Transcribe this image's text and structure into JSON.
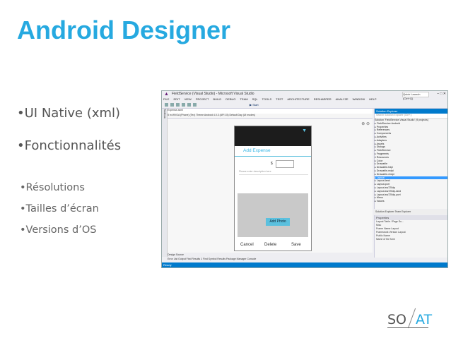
{
  "slide": {
    "title": "Android Designer",
    "bullets": [
      "•UI Native (xml)",
      "•Fonctionnalités"
    ],
    "sub_bullets": [
      "•Résolutions",
      "•Tailles d’écran",
      "•Versions d’OS"
    ]
  },
  "ide": {
    "title": "FieldService (Visual Studio) - Microsoft Visual Studio",
    "menu": [
      "FILE",
      "EDIT",
      "VIEW",
      "PROJECT",
      "BUILD",
      "DEBUG",
      "TEAM",
      "SQL",
      "TOOLS",
      "TEST",
      "ARCHITECTURE",
      "RESHARPER",
      "ANALYZE",
      "WINDOW",
      "HELP"
    ],
    "quick_launch": "Quick Launch (Ctrl+Q)",
    "start_label": "▶ Start",
    "designer_tab": "Expense.axml",
    "designer_bar": "5 in WVGA (Phone) (Tex)  Theme  Android 4.0.3 (API 15)  Default  Day  (UI modes)",
    "toolbox_label": "Toolbox",
    "zoom": "⊕ ⊖",
    "phone": {
      "header": "Add Expense",
      "currency": "$",
      "description_placeholder": "Please enter description here",
      "photo_button": "Add Photo",
      "actions": [
        "Cancel",
        "Delete",
        "Save"
      ]
    },
    "solution_explorer": {
      "title": "Solution Explorer",
      "search": "Search Solution Explorer (Ctrl+;)",
      "items": [
        "Solution 'FieldService.Visual Studio' (9 projects)",
        "▸ FieldService.Android",
        "   ▸ Properties",
        "   ▸ References",
        "   ▸ Components",
        "   ▸ Activities",
        "   ▸ Adapters",
        "   ▸ Assets",
        "   ▸ Dialogs",
        "   ▸ FieldService",
        "   ▸ Fragments",
        "   ▾ Resources",
        "      ▸ Color",
        "      ▸ Drawable",
        "      ▸ Drawable-hdpi",
        "      ▸ Drawable-mdpi",
        "      ▸ Drawable-xhdpi",
        "      ▸ Layout",
        "      ▸ Layout-land",
        "      ▸ Layout-port",
        "      ▸ Layout-sw720dp",
        "      ▸ Layout-sw720dp-land",
        "      ▸ Layout-sw720dp-port",
        "      ▸ Menu",
        "      ▸ Values"
      ],
      "selected_index": 17,
      "tabs": "Solution Explorer  Team Explorer"
    },
    "properties": {
      "title": "Properties",
      "subtitle": "Layout  Table / Page Su...",
      "rows": [
        "Misc",
        "Frame Name        Layout",
        "Framework Version   Layout",
        "Public Name",
        "Name of the form"
      ]
    },
    "bottom_tabs": "Design  Source",
    "bottom_tabs2": "Error List   Output   Find Results 1   Find Symbol Results   Package Manager Console",
    "status": "Ready"
  },
  "logo": {
    "left": "SO",
    "right": "AT"
  }
}
